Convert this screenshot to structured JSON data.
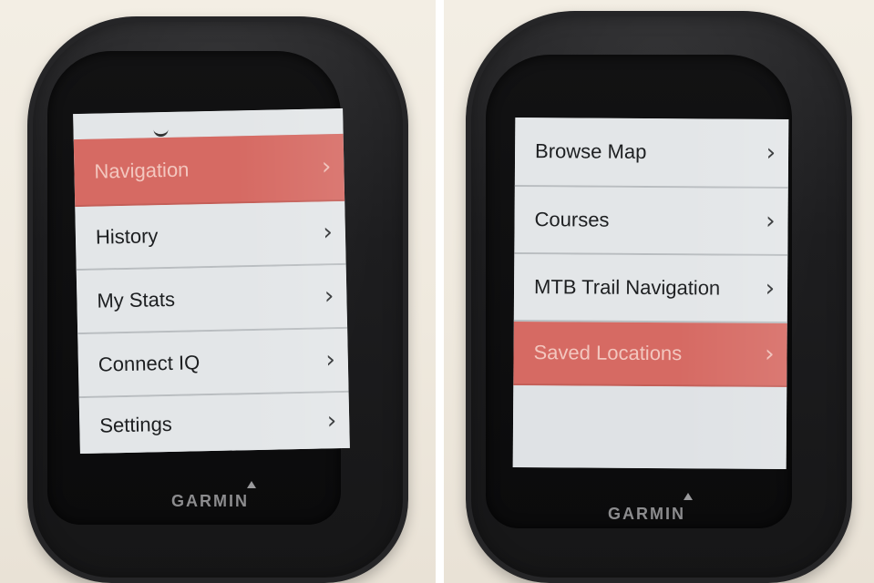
{
  "left_device": {
    "brand": "GARMIN",
    "menu": [
      {
        "label": "Navigation",
        "selected": true
      },
      {
        "label": "History",
        "selected": false
      },
      {
        "label": "My Stats",
        "selected": false
      },
      {
        "label": "Connect IQ",
        "selected": false
      },
      {
        "label": "Settings",
        "selected": false
      }
    ],
    "chevron": "›"
  },
  "right_device": {
    "brand": "GARMIN",
    "menu": [
      {
        "label": "Browse Map",
        "selected": false
      },
      {
        "label": "Courses",
        "selected": false
      },
      {
        "label": "MTB Trail Navigation",
        "selected": false
      },
      {
        "label": "Saved Locations",
        "selected": true
      }
    ],
    "chevron": "›"
  },
  "colors": {
    "highlight": "#d66a63",
    "row": "#e3e6e8",
    "case": "#1d1d1f"
  },
  "icons": [
    "chevron-right-icon",
    "garmin-logo-triangle-icon"
  ]
}
